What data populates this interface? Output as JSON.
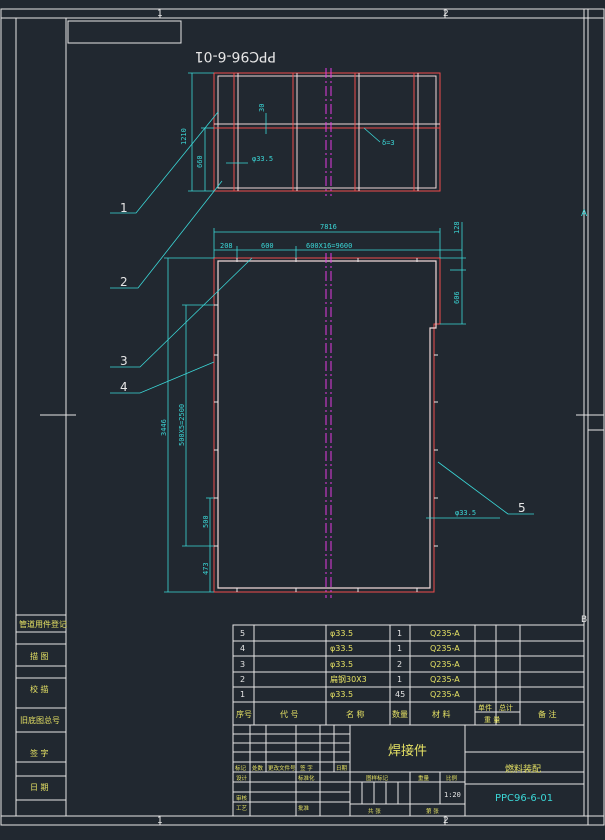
{
  "frame": {
    "zone_top_left": "1",
    "zone_top_right": "2",
    "zone_bottom_left": "1",
    "zone_bottom_right": "2",
    "zone_side_a": "A",
    "zone_side_b": "B"
  },
  "mirrored_code": "PPC96-6-01",
  "side_panel": [
    "管道用件登记",
    "描 图",
    "校 描",
    "旧底图总号",
    "签 字",
    "日 期"
  ],
  "top_view": {
    "dim_height": "1210",
    "dim_lower": "660",
    "dim_small": "30",
    "pipe_label": "φ33.5",
    "plate_label": "δ=3"
  },
  "main_view": {
    "dim_total_width": "7816",
    "dim_left_offset": "208",
    "dim_first_span": "600",
    "dim_repeat": "600X16=9600",
    "dim_right_top": "128",
    "dim_notch": "606",
    "dim_total_height": "3446",
    "dim_repeat_vertical": "500X5=2500",
    "dim_bottom_span": "500",
    "dim_bottom_offset": "473",
    "pipe_label": "φ33.5"
  },
  "callouts": [
    "1",
    "2",
    "3",
    "4",
    "5"
  ],
  "bom": {
    "rows": [
      {
        "no": "5",
        "code": "",
        "name": "φ33.5",
        "qty": "1",
        "material": "Q235-A"
      },
      {
        "no": "4",
        "code": "",
        "name": "φ33.5",
        "qty": "1",
        "material": "Q235-A"
      },
      {
        "no": "3",
        "code": "",
        "name": "φ33.5",
        "qty": "2",
        "material": "Q235-A"
      },
      {
        "no": "2",
        "code": "",
        "name": "扁钢30X3",
        "qty": "1",
        "material": "Q235-A"
      },
      {
        "no": "1",
        "code": "",
        "name": "φ33.5",
        "qty": "45",
        "material": "Q235-A"
      }
    ],
    "headers": {
      "no": "序号",
      "code": "代 号",
      "name": "名 称",
      "qty": "数量",
      "material": "材 料",
      "unit_weight": "单件",
      "total_weight": "总计",
      "weight": "重 量",
      "remark": "备 注"
    }
  },
  "title_block": {
    "part_name": "焊接件",
    "company": "燃料装配",
    "drawing_no": "PPC96-6-01",
    "scale": "1:20",
    "revision_labels": [
      "标记",
      "处数",
      "更改文件号",
      "签 字",
      "日期"
    ],
    "design_label": "设计",
    "standard_label": "标准化",
    "review_label": "审核",
    "process_label": "工艺",
    "approve_label": "批准",
    "stage_label": "图样标记",
    "weight_label": "重量",
    "scale_label": "比例",
    "sheet_total_label": "共 张",
    "sheet_label": "第 张"
  }
}
